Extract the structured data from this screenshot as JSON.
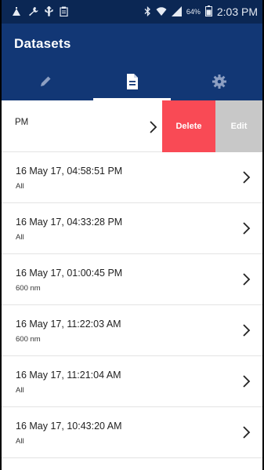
{
  "status_bar": {
    "battery_percent": "64%",
    "time": "2:03 PM",
    "left_icons": [
      "notification-icon",
      "wrench-icon",
      "usb-icon",
      "clipboard-icon"
    ],
    "right_icons": [
      "bluetooth-icon",
      "wifi-icon",
      "signal-icon",
      "battery-icon"
    ]
  },
  "header": {
    "title": "Datasets",
    "tabs": [
      {
        "icon": "pencil-icon",
        "active": false
      },
      {
        "icon": "document-icon",
        "active": true
      },
      {
        "icon": "gear-icon",
        "active": false
      }
    ]
  },
  "swiped_row": {
    "text": "PM",
    "delete_label": "Delete",
    "edit_label": "Edit"
  },
  "datasets": [
    {
      "date": "16 May 17, 04:58:51 PM",
      "filter": "All"
    },
    {
      "date": "16 May 17, 04:33:28 PM",
      "filter": "All"
    },
    {
      "date": "16 May 17, 01:00:45 PM",
      "filter": "600 nm"
    },
    {
      "date": "16 May 17, 11:22:03 AM",
      "filter": "600 nm"
    },
    {
      "date": "16 May 17, 11:21:04 AM",
      "filter": "All"
    },
    {
      "date": "16 May 17, 10:43:20 AM",
      "filter": "All"
    }
  ],
  "colors": {
    "status_bar": "#0b2754",
    "header": "#123775",
    "delete": "#f94a55",
    "edit": "#c8c8c8"
  }
}
